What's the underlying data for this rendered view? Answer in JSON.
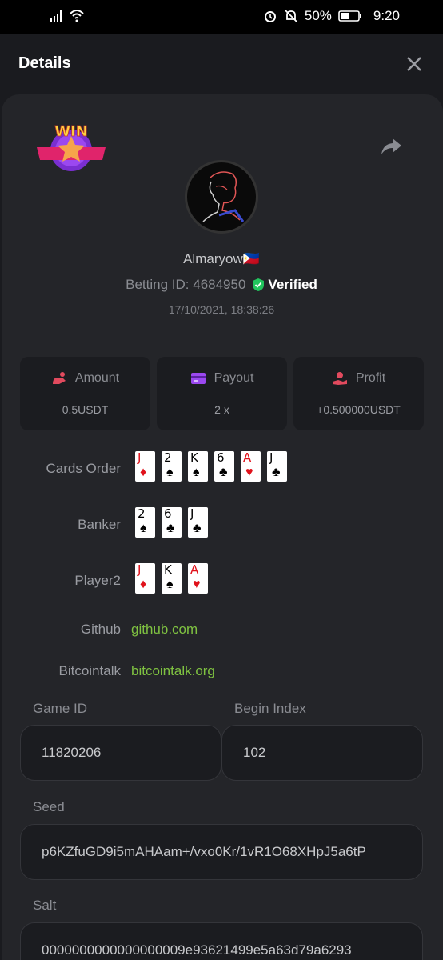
{
  "status_bar": {
    "battery": "50%",
    "time": "9:20"
  },
  "header": {
    "title": "Details"
  },
  "win_badge": {
    "text": "WIN"
  },
  "user": {
    "name": "Almaryow🇵🇭",
    "betting_id": "Betting ID: 4684950",
    "verified": "Verified",
    "timestamp": "17/10/2021, 18:38:26"
  },
  "stats": {
    "amount_label": "Amount",
    "amount_value": "0.5USDT",
    "payout_label": "Payout",
    "payout_value": "2 x",
    "profit_label": "Profit",
    "profit_value": "+0.500000USDT"
  },
  "cards_order": {
    "label": "Cards Order",
    "cards": [
      {
        "rank": "J",
        "suit": "♦"
      },
      {
        "rank": "2",
        "suit": "♠"
      },
      {
        "rank": "K",
        "suit": "♠"
      },
      {
        "rank": "6",
        "suit": "♣"
      },
      {
        "rank": "A",
        "suit": "♥"
      },
      {
        "rank": "J",
        "suit": "♣"
      }
    ]
  },
  "banker": {
    "label": "Banker",
    "cards": [
      {
        "rank": "2",
        "suit": "♠"
      },
      {
        "rank": "6",
        "suit": "♣"
      },
      {
        "rank": "J",
        "suit": "♣"
      }
    ]
  },
  "player2": {
    "label": "Player2",
    "cards": [
      {
        "rank": "J",
        "suit": "♦"
      },
      {
        "rank": "K",
        "suit": "♠"
      },
      {
        "rank": "A",
        "suit": "♥"
      }
    ]
  },
  "links": {
    "github_label": "Github",
    "github_value": "github.com",
    "bitcointalk_label": "Bitcointalk",
    "bitcointalk_value": "bitcointalk.org"
  },
  "fields": {
    "game_id_label": "Game ID",
    "game_id_value": "11820206",
    "begin_index_label": "Begin Index",
    "begin_index_value": "102",
    "seed_label": "Seed",
    "seed_value": "p6KZfuGD9i5mAHAam+/vxo0Kr/1vR1O68XHpJ5a6tP",
    "salt_label": "Salt",
    "salt_value": "0000000000000000009e93621499e5a63d79a6293"
  },
  "colors": {
    "link": "#7fc241",
    "verified": "#22c55e",
    "accent_red": "#e0121b"
  }
}
